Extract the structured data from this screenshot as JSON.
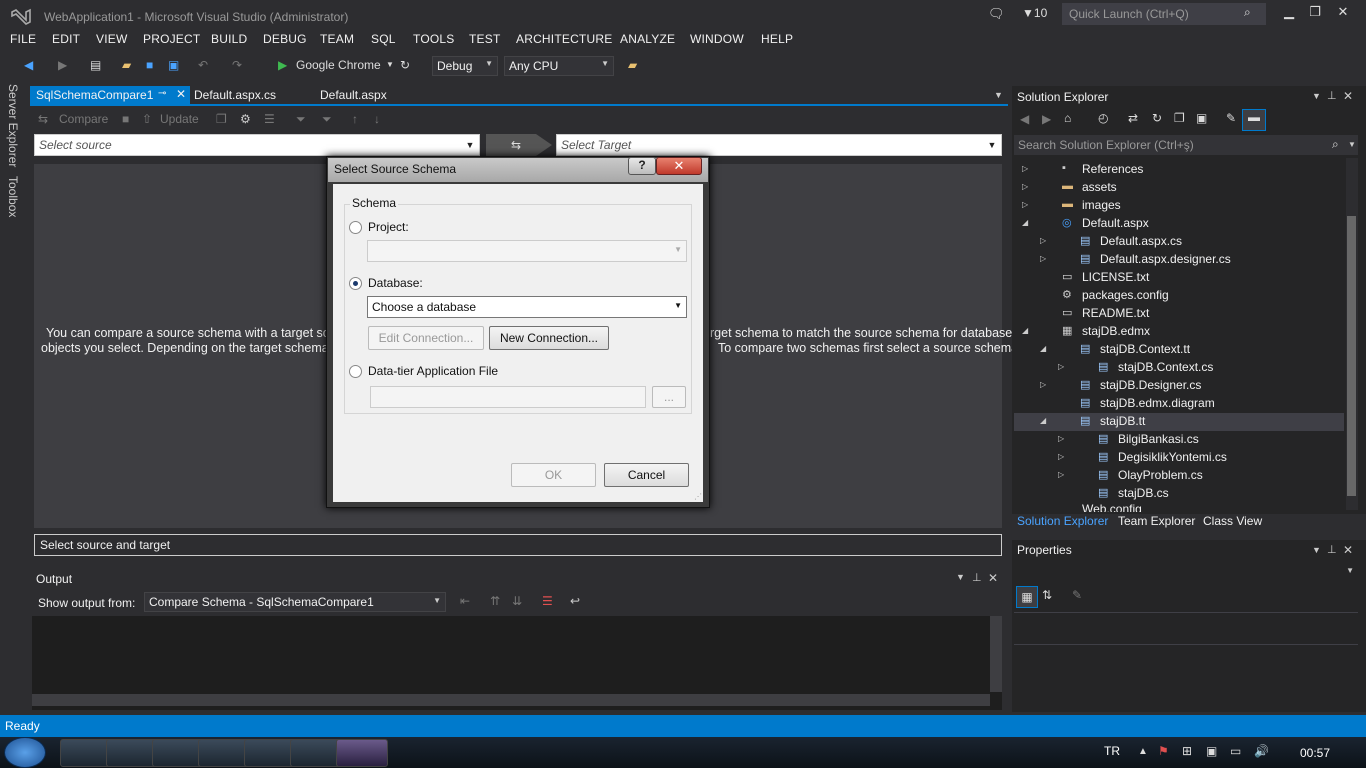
{
  "window": {
    "title": "WebApplication1 - Microsoft Visual Studio (Administrator)",
    "notifications_count": "10",
    "quick_launch_placeholder": "Quick Launch (Ctrl+Q)"
  },
  "menu": [
    "FILE",
    "EDIT",
    "VIEW",
    "PROJECT",
    "BUILD",
    "DEBUG",
    "TEAM",
    "SQL",
    "TOOLS",
    "TEST",
    "ARCHITECTURE",
    "ANALYZE",
    "WINDOW",
    "HELP"
  ],
  "toolbar": {
    "browser": "Google Chrome",
    "configuration": "Debug",
    "platform": "Any CPU"
  },
  "left_strip": {
    "server_explorer": "Server Explorer",
    "toolbox": "Toolbox"
  },
  "doc_tabs": [
    "SqlSchemaCompare1",
    "Default.aspx.cs",
    "Default.aspx"
  ],
  "schema_compare": {
    "compare_label": "Compare",
    "update_label": "Update",
    "source_placeholder": "Select source",
    "target_placeholder": "Select Target",
    "description_left_1": "You can compare a source schema with a target sche",
    "description_left_2": "objects you select.  Depending on the target schema t",
    "description_right_1": "rget schema to match the source schema for database",
    "description_right_2": "To compare two schemas first select a source schema",
    "status_line": "Select source and target"
  },
  "output": {
    "title": "Output",
    "show_from_label": "Show output from:",
    "show_from_value": "Compare Schema - SqlSchemaCompare1"
  },
  "dialog": {
    "title": "Select Source Schema",
    "help": "?",
    "close": "✕",
    "group_label": "Schema",
    "project_label": "Project:",
    "database_label": "Database:",
    "database_value": "Choose a database",
    "edit_connection": "Edit Connection...",
    "new_connection": "New Connection...",
    "dacpac_label": "Data-tier Application File",
    "browse": "...",
    "ok": "OK",
    "cancel": "Cancel",
    "selected_option": "Database"
  },
  "solution_explorer": {
    "title": "Solution Explorer",
    "search_placeholder": "Search Solution Explorer (Ctrl+ş)",
    "items": [
      {
        "label": "References",
        "indent": 0,
        "exp": "right",
        "icon": "references-icon"
      },
      {
        "label": "assets",
        "indent": 0,
        "exp": "right",
        "icon": "folder-icon"
      },
      {
        "label": "images",
        "indent": 0,
        "exp": "right",
        "icon": "folder-icon"
      },
      {
        "label": "Default.aspx",
        "indent": 0,
        "exp": "down",
        "icon": "web-page-icon"
      },
      {
        "label": "Default.aspx.cs",
        "indent": 1,
        "exp": "right",
        "icon": "csharp-file-icon"
      },
      {
        "label": "Default.aspx.designer.cs",
        "indent": 1,
        "exp": "right",
        "icon": "csharp-file-icon"
      },
      {
        "label": "LICENSE.txt",
        "indent": 0,
        "exp": "",
        "icon": "text-file-icon"
      },
      {
        "label": "packages.config",
        "indent": 0,
        "exp": "",
        "icon": "config-file-icon"
      },
      {
        "label": "README.txt",
        "indent": 0,
        "exp": "",
        "icon": "text-file-icon"
      },
      {
        "label": "stajDB.edmx",
        "indent": 0,
        "exp": "down",
        "icon": "edmx-icon"
      },
      {
        "label": "stajDB.Context.tt",
        "indent": 1,
        "exp": "down",
        "icon": "template-file-icon"
      },
      {
        "label": "stajDB.Context.cs",
        "indent": 2,
        "exp": "right",
        "icon": "csharp-file-icon"
      },
      {
        "label": "stajDB.Designer.cs",
        "indent": 1,
        "exp": "right",
        "icon": "csharp-file-icon"
      },
      {
        "label": "stajDB.edmx.diagram",
        "indent": 1,
        "exp": "",
        "icon": "diagram-file-icon"
      },
      {
        "label": "stajDB.tt",
        "indent": 1,
        "exp": "down",
        "icon": "template-file-icon"
      },
      {
        "label": "BilgiBankasi.cs",
        "indent": 2,
        "exp": "right",
        "icon": "csharp-file-icon"
      },
      {
        "label": "DegisiklikYontemi.cs",
        "indent": 2,
        "exp": "right",
        "icon": "csharp-file-icon"
      },
      {
        "label": "OlayProblem.cs",
        "indent": 2,
        "exp": "right",
        "icon": "csharp-file-icon"
      },
      {
        "label": "stajDB.cs",
        "indent": 2,
        "exp": "",
        "icon": "csharp-file-icon"
      }
    ],
    "partial_item": "Web.config",
    "tabs": [
      "Solution Explorer",
      "Team Explorer",
      "Class View"
    ]
  },
  "properties": {
    "title": "Properties"
  },
  "status": "Ready",
  "taskbar": {
    "language": "TR",
    "clock": "00:57"
  }
}
